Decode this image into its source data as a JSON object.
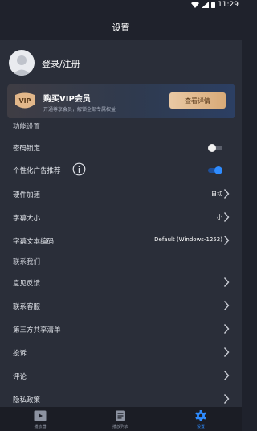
{
  "statusbar": {
    "time": "11:29"
  },
  "header": {
    "title": "设置"
  },
  "profile": {
    "login_label": "登录/注册"
  },
  "vip_banner": {
    "badge": "VIP",
    "title": "购买VIP会员",
    "subtitle": "开通尊享会员，解锁全部专属权益",
    "button": "查看详情"
  },
  "sections": {
    "features": "功能设置",
    "contact": "联系我们"
  },
  "settings": {
    "password_lock": {
      "label": "密码锁定",
      "enabled": false
    },
    "personalized_ads": {
      "label": "个性化广告推荐",
      "enabled": true
    },
    "hardware_accel": {
      "label": "硬件加速",
      "value": "自动"
    },
    "subtitle_size": {
      "label": "字幕大小",
      "value": "小"
    },
    "subtitle_encoding": {
      "label": "字幕文本编码",
      "value": "Default (Windows-1252)"
    }
  },
  "contact_items": [
    "意见反馈",
    "联系客服",
    "第三方共享清单",
    "投诉",
    "评论",
    "隐私政策"
  ],
  "tabs": [
    {
      "label": "播放器",
      "icon": "play-icon",
      "active": false
    },
    {
      "label": "播放列表",
      "icon": "list-icon",
      "active": false
    },
    {
      "label": "设置",
      "icon": "gear-icon",
      "active": true
    }
  ],
  "colors": {
    "accent": "#2f8cff",
    "vip_gold": "#d8aa78",
    "background": "#2a2e39"
  }
}
